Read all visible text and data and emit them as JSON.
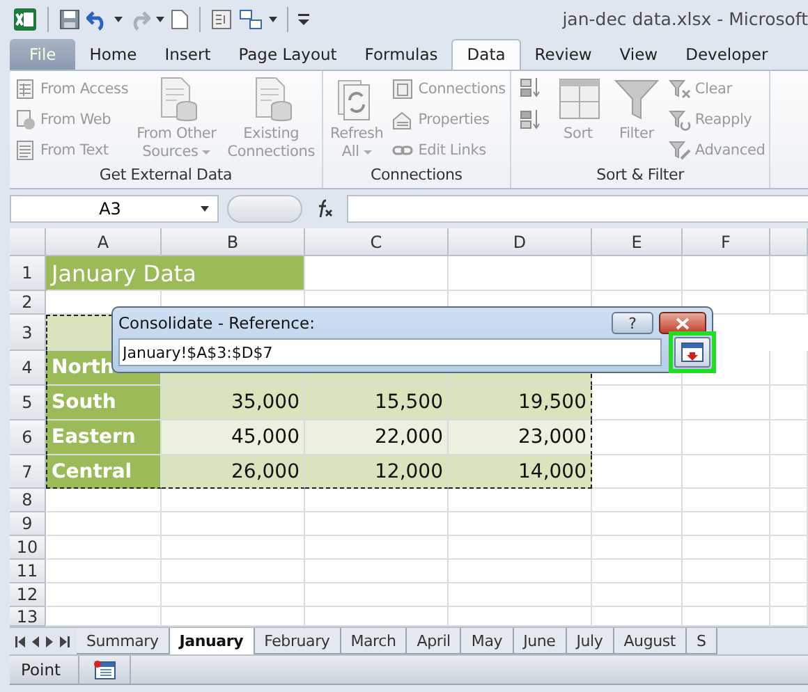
{
  "window": {
    "title": "jan-dec data.xlsx  -  Microsoft"
  },
  "ribbon_tabs": [
    {
      "label": "File",
      "selected": false,
      "kind": "file"
    },
    {
      "label": "Home",
      "selected": false,
      "kind": "tab"
    },
    {
      "label": "Insert",
      "selected": false,
      "kind": "tab"
    },
    {
      "label": "Page Layout",
      "selected": false,
      "kind": "tab"
    },
    {
      "label": "Formulas",
      "selected": false,
      "kind": "tab"
    },
    {
      "label": "Data",
      "selected": true,
      "kind": "tab"
    },
    {
      "label": "Review",
      "selected": false,
      "kind": "tab"
    },
    {
      "label": "View",
      "selected": false,
      "kind": "tab"
    },
    {
      "label": "Developer",
      "selected": false,
      "kind": "tab"
    }
  ],
  "ribbon": {
    "disabled": true,
    "groups": [
      {
        "label": "Get External Data",
        "items": [
          {
            "kind": "small",
            "label": "From Access"
          },
          {
            "kind": "small",
            "label": "From Web"
          },
          {
            "kind": "small",
            "label": "From Text"
          },
          {
            "kind": "large",
            "lines": [
              "From Other",
              "Sources"
            ],
            "dropdown": true
          },
          {
            "kind": "large",
            "lines": [
              "Existing",
              "Connections"
            ],
            "dropdown": false
          }
        ]
      },
      {
        "label": "Connections",
        "items": [
          {
            "kind": "large",
            "lines": [
              "Refresh",
              "All"
            ],
            "dropdown": true
          },
          {
            "kind": "small",
            "label": "Connections"
          },
          {
            "kind": "small",
            "label": "Properties"
          },
          {
            "kind": "small",
            "label": "Edit Links"
          }
        ]
      },
      {
        "label": "Sort & Filter",
        "items": [
          {
            "kind": "sort_pair"
          },
          {
            "kind": "large",
            "lines": [
              "Sort"
            ],
            "dropdown": false
          },
          {
            "kind": "large",
            "lines": [
              "Filter"
            ],
            "dropdown": false
          },
          {
            "kind": "small",
            "label": "Clear"
          },
          {
            "kind": "small",
            "label": "Reapply"
          },
          {
            "kind": "small",
            "label": "Advanced"
          }
        ]
      }
    ]
  },
  "formula_bar": {
    "name_box": "A3"
  },
  "columns": [
    "A",
    "B",
    "C",
    "D",
    "E",
    "F"
  ],
  "rows": [
    {
      "number": "1",
      "kind": "title",
      "in_range": false,
      "cells": [
        "January Data"
      ]
    },
    {
      "number": "2",
      "kind": "blank",
      "in_range": false
    },
    {
      "number": "3",
      "kind": "header",
      "in_range": true
    },
    {
      "number": "4",
      "kind": "data",
      "in_range": true,
      "alt": false,
      "cells": [
        "North"
      ]
    },
    {
      "number": "5",
      "kind": "data",
      "in_range": true,
      "alt": false,
      "cells": [
        "South",
        "35,000",
        "15,500",
        "19,500"
      ]
    },
    {
      "number": "6",
      "kind": "data",
      "in_range": true,
      "alt": true,
      "cells": [
        "Eastern",
        "45,000",
        "22,000",
        "23,000"
      ]
    },
    {
      "number": "7",
      "kind": "data",
      "in_range": true,
      "alt": false,
      "cells": [
        "Central",
        "26,000",
        "12,000",
        "14,000"
      ]
    },
    {
      "number": "8",
      "kind": "blank",
      "in_range": false
    },
    {
      "number": "9",
      "kind": "blank",
      "in_range": false
    },
    {
      "number": "10",
      "kind": "blank",
      "in_range": false
    },
    {
      "number": "11",
      "kind": "blank",
      "in_range": false
    },
    {
      "number": "12",
      "kind": "blank",
      "in_range": false
    },
    {
      "number": "13",
      "kind": "blank",
      "in_range": false
    }
  ],
  "dialog": {
    "title": "Consolidate - Reference:",
    "help": "?",
    "value": "January!$A$3:$D$7",
    "collapse_highlighted": true
  },
  "sheet_tabs": [
    {
      "label": "Summary",
      "selected": false
    },
    {
      "label": "January",
      "selected": true
    },
    {
      "label": "February",
      "selected": false
    },
    {
      "label": "March",
      "selected": false
    },
    {
      "label": "April",
      "selected": false
    },
    {
      "label": "May",
      "selected": false
    },
    {
      "label": "June",
      "selected": false
    },
    {
      "label": "July",
      "selected": false
    },
    {
      "label": "August",
      "selected": false
    },
    {
      "label": "S",
      "selected": false
    }
  ],
  "status_bar": {
    "mode": "Point"
  }
}
